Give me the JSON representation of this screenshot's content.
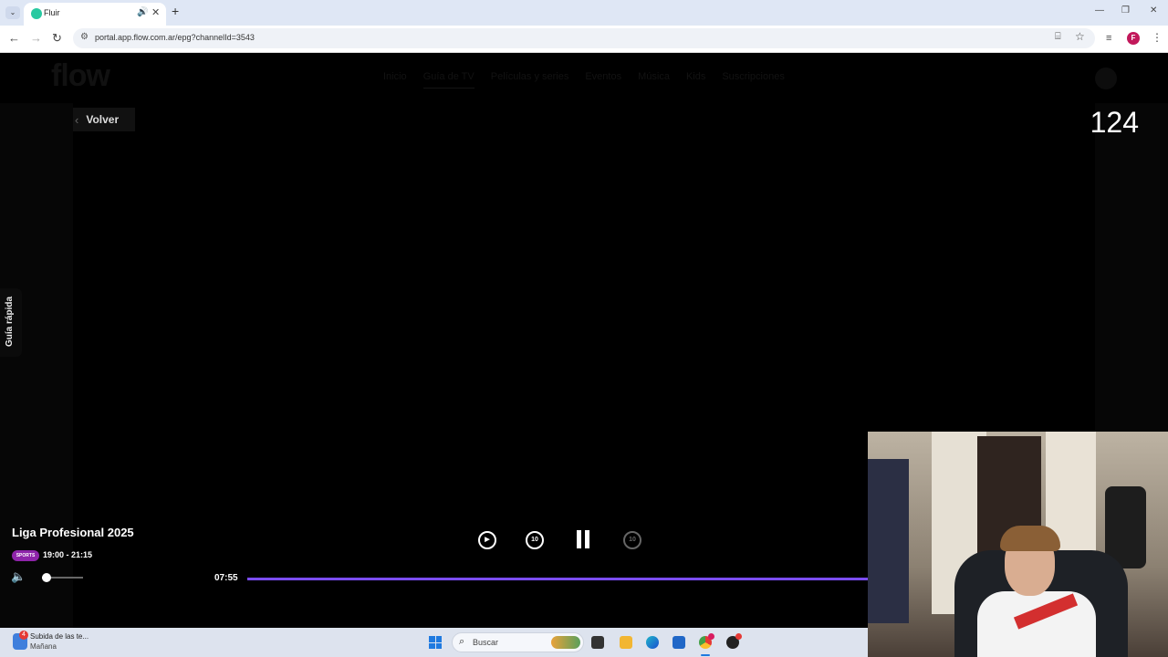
{
  "browser": {
    "tab_title": "Fluir",
    "url": "portal.app.flow.com.ar/epg?channelId=3543",
    "profile_initial": "F"
  },
  "site": {
    "logo_text": "flow",
    "nav_items": [
      "Inicio",
      "Guía de TV",
      "Películas y series",
      "Eventos",
      "Música",
      "Kids",
      "Suscripciones"
    ],
    "back_label": "Volver",
    "quick_guide_label": "Guía rápida"
  },
  "player": {
    "channel_number": "124",
    "program_title": "Liga Profesional 2025",
    "channel_logo_text": "SPORTS",
    "program_time": "19:00 - 21:15",
    "rewind_seconds": "10",
    "forward_seconds": "10",
    "elapsed": "07:55",
    "progress_fraction": 1.0,
    "volume_fraction": 0.1,
    "accent_color": "#7c4dff"
  },
  "taskbar": {
    "news_badge": "4",
    "news_title": "Subida de las te...",
    "news_subtitle": "Mañana",
    "search_placeholder": "Buscar"
  }
}
